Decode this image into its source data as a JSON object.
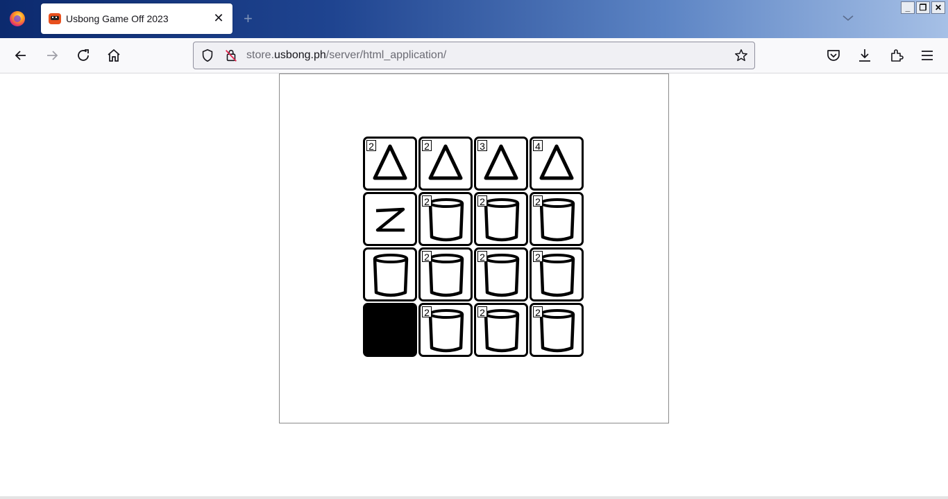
{
  "browser": {
    "tab_title": "Usbong Game Off 2023",
    "url_prefix": "store.",
    "url_domain": "usbong.ph",
    "url_path": "/server/html_application/"
  },
  "colors": {
    "titlebar_start": "#0c2a6e",
    "titlebar_end": "#a6c0e6",
    "tile_border": "#000000",
    "empty_tile": "#000000"
  },
  "game": {
    "rows": [
      [
        {
          "shape": "triangle-icon",
          "count": "2"
        },
        {
          "shape": "triangle-icon",
          "count": "2"
        },
        {
          "shape": "triangle-icon",
          "count": "3"
        },
        {
          "shape": "triangle-icon",
          "count": "4"
        }
      ],
      [
        {
          "shape": "z-icon",
          "count": ""
        },
        {
          "shape": "cylinder-icon",
          "count": "2"
        },
        {
          "shape": "cylinder-icon",
          "count": "2"
        },
        {
          "shape": "cylinder-icon",
          "count": "2"
        }
      ],
      [
        {
          "shape": "cylinder-icon",
          "count": ""
        },
        {
          "shape": "cylinder-icon",
          "count": "2"
        },
        {
          "shape": "cylinder-icon",
          "count": "2"
        },
        {
          "shape": "cylinder-icon",
          "count": "2"
        }
      ],
      [
        {
          "shape": "empty",
          "count": ""
        },
        {
          "shape": "cylinder-icon",
          "count": "2"
        },
        {
          "shape": "cylinder-icon",
          "count": "2"
        },
        {
          "shape": "cylinder-icon",
          "count": "2"
        }
      ]
    ]
  }
}
